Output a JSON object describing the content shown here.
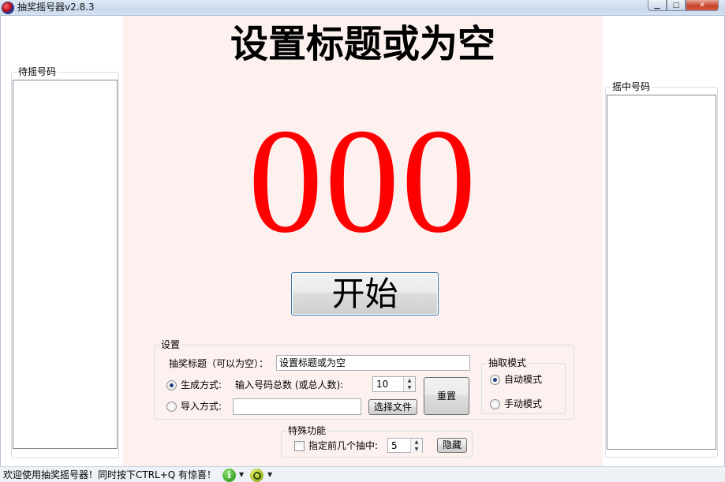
{
  "window": {
    "title": "抽奖摇号器v2.8.3",
    "controls": {
      "minimize": "▁",
      "maximize": "□",
      "close": "✕"
    }
  },
  "main": {
    "title": "设置标题或为空",
    "number": "000",
    "start_button": "开始",
    "number_color": "#ff0000"
  },
  "left_panel": {
    "label": "待摇号码"
  },
  "right_panel": {
    "label": "摇中号码"
  },
  "settings": {
    "label": "设置",
    "title_label": "抽奖标题（可以为空）：",
    "title_value": "设置标题或为空",
    "generate_label": "生成方式:",
    "total_label": "输入号码总数 (或总人数):",
    "total_value": "10",
    "import_label": "导入方式:",
    "import_path_value": "",
    "choose_file_button": "选择文件",
    "reset_button": "重置"
  },
  "mode": {
    "label": "抽取模式",
    "auto_label": "自动模式",
    "manual_label": "手动模式"
  },
  "special": {
    "label": "特殊功能",
    "first_n_label": "指定前几个抽中:",
    "first_n_value": "5",
    "hide_button": "隐藏"
  },
  "statusbar": {
    "text": "欢迎使用抽奖摇号器！同时按下CTRL+Q 有惊喜！",
    "info_icon_glyph": "i"
  }
}
